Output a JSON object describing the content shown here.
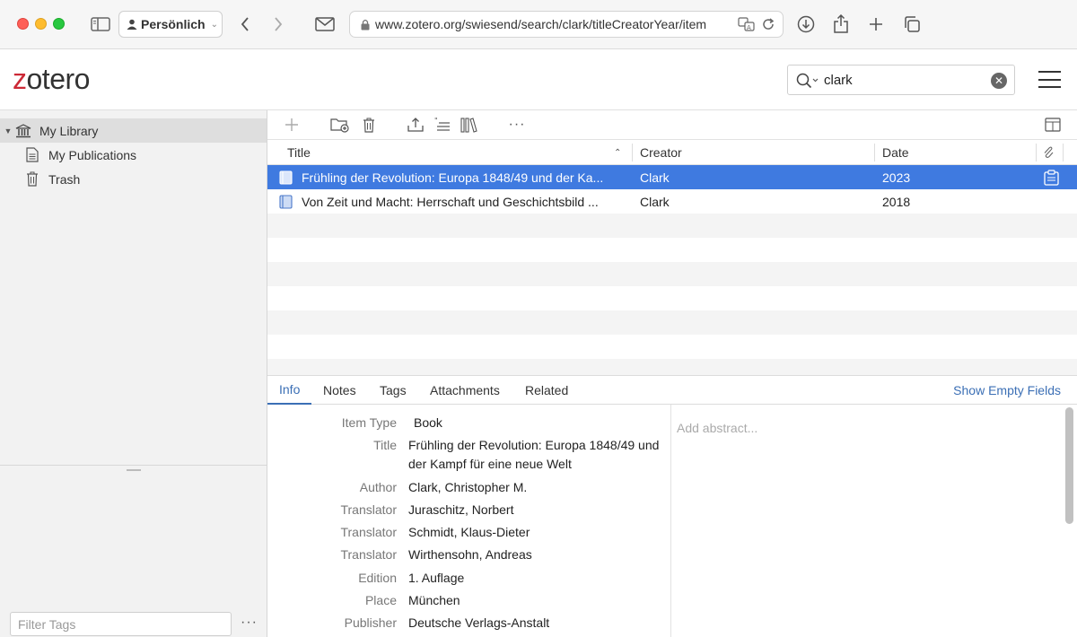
{
  "browser": {
    "profile_label": "Persönlich",
    "url": "www.zotero.org/swiesend/search/clark/titleCreatorYear/item"
  },
  "header": {
    "logo_prefix": "z",
    "logo_rest": "otero",
    "search_value": "clark"
  },
  "sidebar": {
    "collections": [
      {
        "label": "My Library",
        "icon": "library-icon"
      },
      {
        "label": "My Publications",
        "icon": "document-icon"
      },
      {
        "label": "Trash",
        "icon": "trash-icon"
      }
    ],
    "filter_placeholder": "Filter Tags",
    "more_label": "···"
  },
  "items": {
    "columns": {
      "title": "Title",
      "creator": "Creator",
      "date": "Date"
    },
    "rows": [
      {
        "title": "Frühling der Revolution: Europa 1848/49 und der Ka...",
        "creator": "Clark",
        "date": "2023"
      },
      {
        "title": "Von Zeit und Macht: Herrschaft und Geschichtsbild ...",
        "creator": "Clark",
        "date": "2018"
      }
    ]
  },
  "item_pane": {
    "tabs": [
      "Info",
      "Notes",
      "Tags",
      "Attachments",
      "Related"
    ],
    "show_empty": "Show Empty Fields",
    "fields": [
      {
        "label": "Item Type",
        "value": "Book"
      },
      {
        "label": "Title",
        "value": "Frühling der Revolution: Europa 1848/49 und der Kampf für eine neue Welt"
      },
      {
        "label": "Author",
        "value": "Clark, Christopher M."
      },
      {
        "label": "Translator",
        "value": "Juraschitz, Norbert"
      },
      {
        "label": "Translator",
        "value": "Schmidt, Klaus-Dieter"
      },
      {
        "label": "Translator",
        "value": "Wirthensohn, Andreas"
      },
      {
        "label": "Edition",
        "value": "1. Auflage"
      },
      {
        "label": "Place",
        "value": "München"
      },
      {
        "label": "Publisher",
        "value": "Deutsche Verlags-Anstalt"
      }
    ],
    "abstract_placeholder": "Add abstract..."
  }
}
